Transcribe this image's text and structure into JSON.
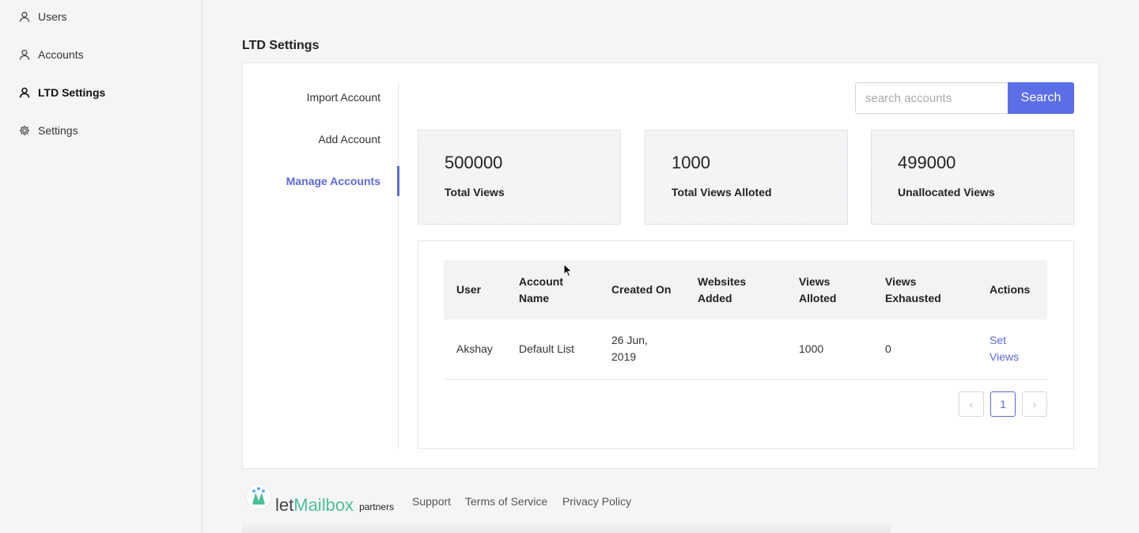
{
  "sidebar": {
    "items": [
      {
        "label": "Users",
        "icon": "user-icon",
        "active": false
      },
      {
        "label": "Accounts",
        "icon": "user-icon",
        "active": false
      },
      {
        "label": "LTD Settings",
        "icon": "user-icon",
        "active": true
      },
      {
        "label": "Settings",
        "icon": "gear-icon",
        "active": false
      }
    ]
  },
  "page": {
    "title": "LTD Settings"
  },
  "subnav": {
    "items": [
      {
        "label": "Import Account"
      },
      {
        "label": "Add Account"
      },
      {
        "label": "Manage Accounts",
        "active": true
      }
    ]
  },
  "search": {
    "placeholder": "search accounts",
    "button_label": "Search"
  },
  "stats": [
    {
      "value": "500000",
      "label": "Total Views"
    },
    {
      "value": "1000",
      "label": "Total Views Alloted"
    },
    {
      "value": "499000",
      "label": "Unallocated Views"
    }
  ],
  "table": {
    "headers": [
      "User",
      "Account Name",
      "Created On",
      "Websites Added",
      "Views Alloted",
      "Views Exhausted",
      "Actions"
    ],
    "rows": [
      {
        "user": "Akshay",
        "account_name": "Default List",
        "created_on": "26 Jun, 2019",
        "websites_added": "",
        "views_alloted": "1000",
        "views_exhausted": "0",
        "action": "Set Views"
      }
    ]
  },
  "pagination": {
    "prev": "‹",
    "current": "1",
    "next": "›"
  },
  "footer": {
    "logo_let": "let",
    "logo_mailbox": "Mailbox",
    "logo_sub": "partners",
    "links": [
      "Support",
      "Terms of Service",
      "Privacy Policy"
    ]
  },
  "colors": {
    "accent": "#5b6ad6",
    "button": "#5b6ee8",
    "brand_green": "#4fbf9b"
  }
}
